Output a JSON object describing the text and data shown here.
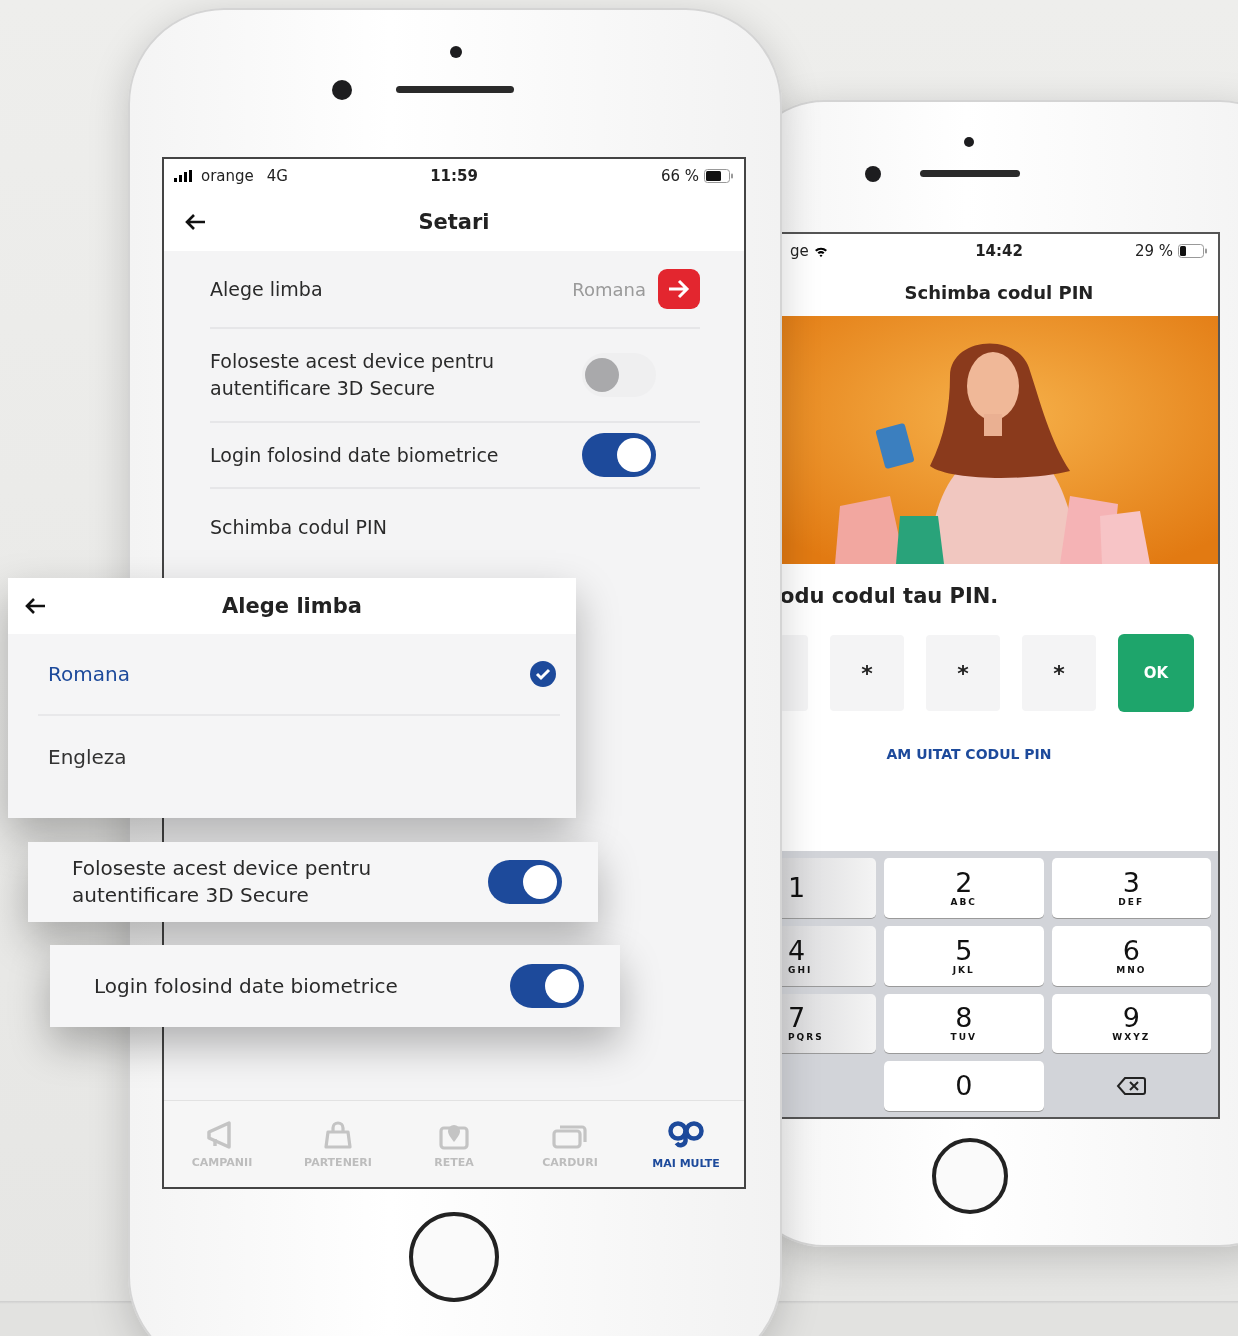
{
  "settings_screen": {
    "status_bar": {
      "carrier": "orange",
      "network": "4G",
      "time": "11:59",
      "battery": "66 %"
    },
    "title": "Setari",
    "rows": [
      {
        "kind": "link",
        "label": "Alege limba",
        "value": "Romana"
      },
      {
        "kind": "toggle",
        "label": "Foloseste acest device pentru autentificare 3D Secure",
        "on": false
      },
      {
        "kind": "toggle",
        "label": "Login folosind date biometrice",
        "on": true
      },
      {
        "kind": "plain",
        "label": "Schimba codul PIN"
      }
    ],
    "tab_bar": [
      {
        "kind": "megaphone",
        "label": "CAMPANII",
        "selected": false
      },
      {
        "kind": "bag",
        "label": "PARTENERI",
        "selected": false
      },
      {
        "kind": "pin",
        "label": "RETEA",
        "selected": false
      },
      {
        "kind": "cards",
        "label": "CARDURI",
        "selected": false
      },
      {
        "kind": "more",
        "label": "MAI MULTE",
        "selected": true
      }
    ]
  },
  "language_dialog": {
    "title": "Alege limba",
    "options": [
      {
        "label": "Romana",
        "selected": true
      },
      {
        "label": "Engleza",
        "selected": false
      }
    ]
  },
  "floating_toggles": [
    {
      "label": "Foloseste acest device pentru autentificare 3D Secure",
      "on": true
    },
    {
      "label": "Login folosind date biometrice",
      "on": true
    }
  ],
  "pin_screen": {
    "status_bar": {
      "carrier": "ge",
      "time": "14:42",
      "battery": "29 %"
    },
    "title": "Schimba codul PIN",
    "prompt": "odu codul tau PIN.",
    "pin_boxes": [
      {
        "kind": "empty"
      },
      {
        "kind": "digit",
        "value": "*"
      },
      {
        "kind": "digit",
        "value": "*"
      },
      {
        "kind": "digit",
        "value": "*"
      }
    ],
    "ok_button": "OK",
    "forgot_link": "AM UITAT CODUL PIN",
    "keypad": [
      {
        "kind": "key",
        "digit": "1"
      },
      {
        "kind": "key",
        "digit": "2",
        "letters": "ABC"
      },
      {
        "kind": "key",
        "digit": "3",
        "letters": "DEF"
      },
      {
        "kind": "key",
        "digit": "4",
        "letters": "GHI"
      },
      {
        "kind": "key",
        "digit": "5",
        "letters": "JKL"
      },
      {
        "kind": "key",
        "digit": "6",
        "letters": "MNO"
      },
      {
        "kind": "key",
        "digit": "7",
        "letters": "PQRS"
      },
      {
        "kind": "key",
        "digit": "8",
        "letters": "TUV"
      },
      {
        "kind": "key",
        "digit": "9",
        "letters": "WXYZ"
      },
      {
        "kind": "blank"
      },
      {
        "kind": "key",
        "digit": "0"
      },
      {
        "kind": "delete"
      }
    ]
  }
}
